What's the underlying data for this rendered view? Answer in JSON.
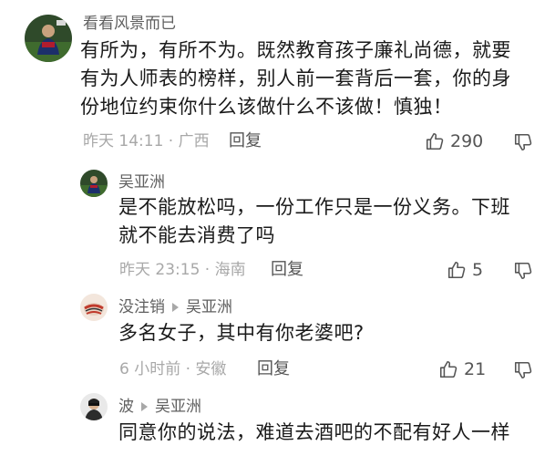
{
  "comments": [
    {
      "author": "看看风景而已",
      "text_lines": [
        "有所为，有所不为。既然教育孩子廉礼尚德，就要",
        "有为人师表的榜样，别人前一套背后一套，你的身",
        "份地位约束你什么该做什么不该做！慎独！"
      ],
      "time_location": "昨天 14:11 · 广西",
      "reply_label": "回复",
      "likes": "290"
    },
    {
      "author": "吴亚洲",
      "text_lines": [
        "是不能放松吗，一份工作只是一份义务。下班",
        "就不能去消费了吗"
      ],
      "time_location": "昨天 23:15 · 海南",
      "reply_label": "回复",
      "likes": "5"
    },
    {
      "author": "没注销",
      "reply_to": "吴亚洲",
      "text_lines": [
        "多名女子，其中有你老婆吧?"
      ],
      "time_location": "6 小时前 · 安徽",
      "reply_label": "回复",
      "likes": "21"
    },
    {
      "author": "波",
      "reply_to": "吴亚洲",
      "text_lines": [
        "同意你的说法，难道去酒吧的不配有好人一样"
      ]
    }
  ],
  "icons": {
    "like": "thumbs-up-icon",
    "dislike": "thumbs-down-icon",
    "reply_arrow": "triangle-right-icon"
  },
  "colors": {
    "name": "#606060",
    "meta": "#a8a8a8",
    "text": "#1a1a1a"
  }
}
